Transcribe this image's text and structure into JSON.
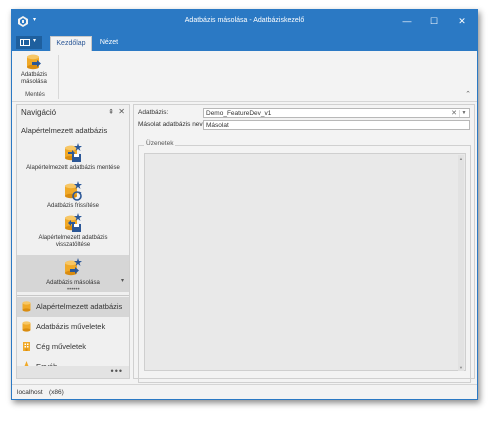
{
  "window": {
    "title": "Adatbázis másolása - Adatbáziskezelő",
    "accent_color": "#2b79c4",
    "controls": {
      "minimize": "—",
      "maximize": "☐",
      "close": "✕"
    }
  },
  "ribbon": {
    "tabs": [
      {
        "label": "Kezdőlap",
        "active": true
      },
      {
        "label": "Nézet",
        "active": false
      }
    ],
    "copy_button": {
      "label_line1": "Adatbázis",
      "label_line2": "másolása",
      "icon": "database-copy-icon"
    },
    "group_label": "Mentés",
    "collapse_glyph": "⌃"
  },
  "navigation": {
    "title": "Navigáció",
    "pin_glyph": "⇞",
    "close_glyph": "✕",
    "group_title": "Alapértelmezett adatbázis",
    "items": [
      {
        "label": "Alapértelmezett adatbázis mentése",
        "icon": "database-save-icon"
      },
      {
        "label": "Adatbázis frissítése",
        "icon": "database-refresh-icon"
      },
      {
        "label_line1": "Alapértelmezett adatbázis",
        "label_line2": "visszatöltése",
        "icon": "database-restore-icon"
      },
      {
        "label": "Adatbázis másolása",
        "icon": "database-copy-icon",
        "selected": true
      }
    ],
    "more_dots": "••••••",
    "groups": [
      {
        "label": "Alapértelmezett adatbázis",
        "icon": "database-icon",
        "active": true
      },
      {
        "label": "Adatbázis műveletek",
        "icon": "database-icon",
        "active": false
      },
      {
        "label": "Cég műveletek",
        "icon": "company-icon",
        "active": false
      },
      {
        "label": "Egyéb",
        "icon": "misc-icon",
        "active": false
      }
    ],
    "footer_menu": "•••"
  },
  "form": {
    "database_label": "Adatbázis:",
    "database_value": "Demo_FeatureDev_v1",
    "copy_name_label": "Másolat adatbázis neve:",
    "copy_name_value": "Másolat",
    "messages_label": "Üzenetek",
    "messages_text": ""
  },
  "statusbar": {
    "server": "localhost",
    "arch": "(x86)"
  }
}
